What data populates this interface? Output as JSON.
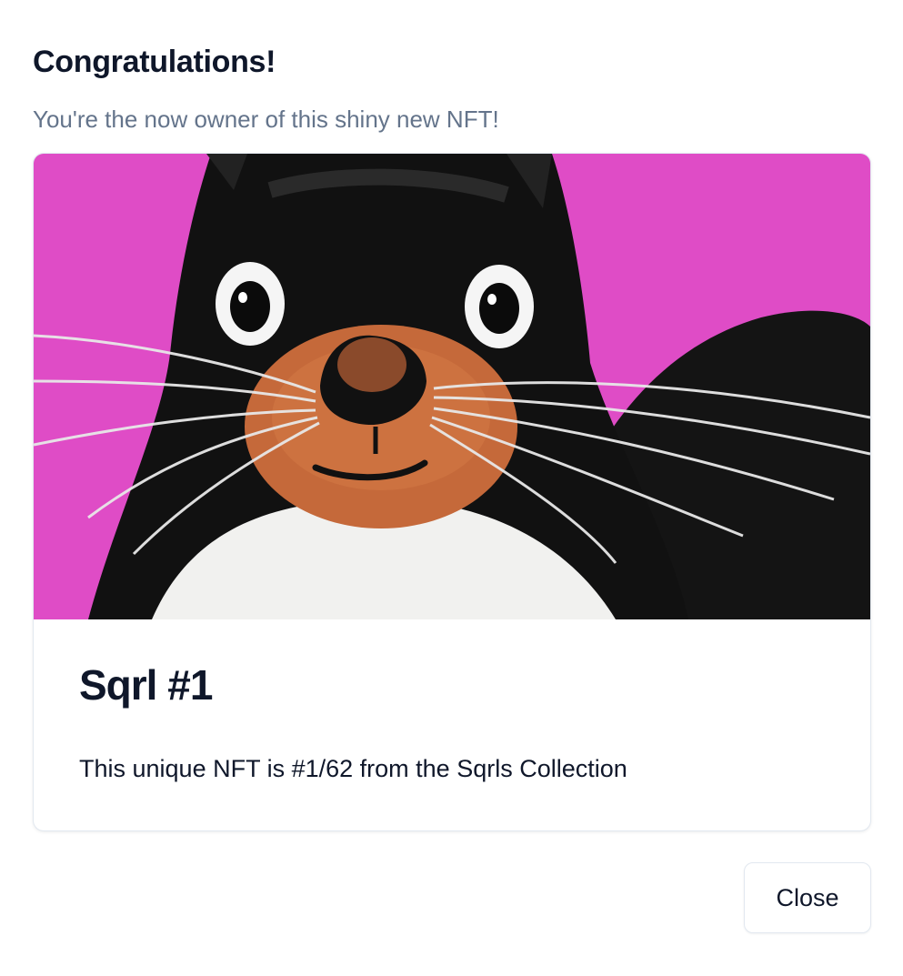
{
  "dialog": {
    "title": "Congratulations!",
    "subtitle": "You're the now owner of this shiny new NFT!",
    "close_label": "Close"
  },
  "nft": {
    "name": "Sqrl #1",
    "description": "This unique NFT is #1/62 from the Sqrls Collection"
  },
  "colors": {
    "background": "#ffffff",
    "title_text": "#0f172a",
    "subtitle_text": "#64748b",
    "border": "#e2e8f0",
    "artwork_background": "#e24fc9"
  }
}
